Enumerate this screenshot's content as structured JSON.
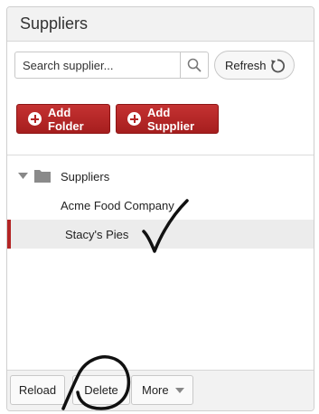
{
  "panel": {
    "title": "Suppliers"
  },
  "search": {
    "placeholder": "Search supplier..."
  },
  "toolbar": {
    "refresh_label": "Refresh",
    "add_folder_label": "Add Folder",
    "add_supplier_label": "Add Supplier"
  },
  "tree": {
    "root_label": "Suppliers",
    "items": [
      {
        "label": "Acme Food Company",
        "selected": false
      },
      {
        "label": "Stacy's Pies",
        "selected": true
      }
    ]
  },
  "footer": {
    "reload_label": "Reload",
    "delete_label": "Delete",
    "more_label": "More"
  },
  "colors": {
    "accent_red": "#b32424",
    "header_bg": "#f2f2f2",
    "selected_row_bg": "#ececec"
  }
}
